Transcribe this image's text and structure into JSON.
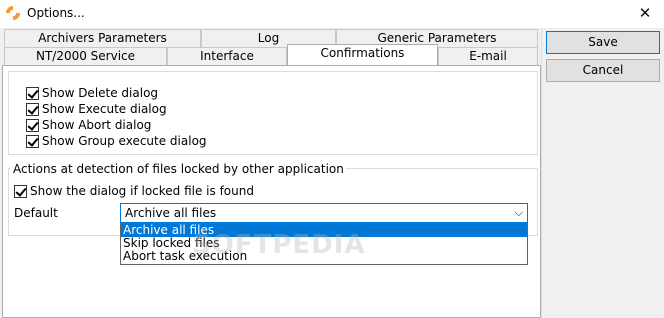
{
  "window": {
    "title": "Options..."
  },
  "tabs": {
    "row1": [
      {
        "label": "Archivers Parameters"
      },
      {
        "label": "Log"
      },
      {
        "label": "Generic Parameters"
      }
    ],
    "row2": [
      {
        "label": "NT/2000 Service"
      },
      {
        "label": "Interface"
      },
      {
        "label": "Confirmations"
      },
      {
        "label": "E-mail"
      }
    ]
  },
  "dialogs": [
    {
      "label": "Show Delete dialog",
      "checked": true
    },
    {
      "label": "Show Execute dialog",
      "checked": true
    },
    {
      "label": "Show Abort dialog",
      "checked": true
    },
    {
      "label": "Show Group execute dialog",
      "checked": true
    }
  ],
  "locked": {
    "group_title": "Actions at detection of files locked by other application",
    "show_dialog": {
      "label": "Show the dialog if locked file is found",
      "checked": true
    },
    "default_label": "Default",
    "selected": "Archive all files",
    "options": [
      "Archive all files",
      "Skip locked files",
      "Abort task execution"
    ]
  },
  "buttons": {
    "save": "Save",
    "cancel": "Cancel"
  },
  "watermark": "SOFTPEDIA"
}
